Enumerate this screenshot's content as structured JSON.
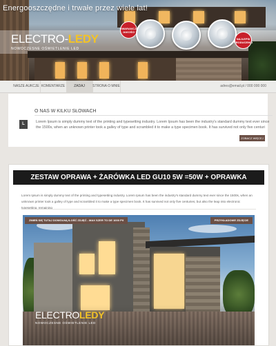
{
  "hero": {
    "banner_text": "Energooszczędne i trwałe przez wiele lat!",
    "logo_main": "ELECTRO-",
    "logo_accent": "LEDY",
    "logo_tagline": "NOWOCZESNE OŚWIETLENIE LED",
    "badge_warranty": "GWARANCJA JAKOŚCI",
    "badge_best": "NAJLEPSI PRODUCENCI"
  },
  "nav": {
    "items": [
      {
        "label": "NASZE AUKCJE"
      },
      {
        "label": "KOMENTARZE"
      },
      {
        "label": "ZADAJ PYTANIE"
      },
      {
        "label": "STRONA O MNIE"
      }
    ],
    "active_index": 2,
    "contact": "adres@email.pl  /  000 000 000"
  },
  "about": {
    "title": "O NAS W KILKU SŁOWACH",
    "icon_letter": "L",
    "text": "Lorem Ipsum is simply dummy text of the printing and typesetting industry. Lorem Ipsum has been the industry's standard dummy text ever since the 1500s, when an unknown printer took a galley of type and scrambled it to make a type specimen book. It has survived not only five centuri",
    "more_button": "ZOBACZ WIĘCEJ"
  },
  "product": {
    "title": "ZESTAW OPRAWA + ŻARÓWKA LED GU10 5W =50W + OPRAWKA",
    "description": "Lorem Ipsum is simply dummy text of the printing and typesetting industry. Lorem Ipsum has been the industry's standard dummy text ever since the 1500s, when an unknown printer took a galley of type and scrambled it to make a type specimen book. It has survived not only five centuries, but also the leap into electronic typesetting, remaining",
    "photo_tag_left": "ZMIEŃ SIĘ TUTAJ DOWOLNĄ ILOŚĆ ZDJĘĆ - MAX SZER TO DE 1000 PX",
    "photo_tag_right": "PRZYKŁADOWE ZDJĘCIE",
    "photo_logo_main": "ELECTRO",
    "photo_logo_accent": "LEDY",
    "photo_logo_tagline": "NOWOCZESNE OŚWIETLENIE LED"
  },
  "colors": {
    "accent_brown": "#6b4f45",
    "logo_yellow": "#f3c326",
    "badge_red": "#c8202a",
    "title_bar": "#1b1b1b"
  }
}
